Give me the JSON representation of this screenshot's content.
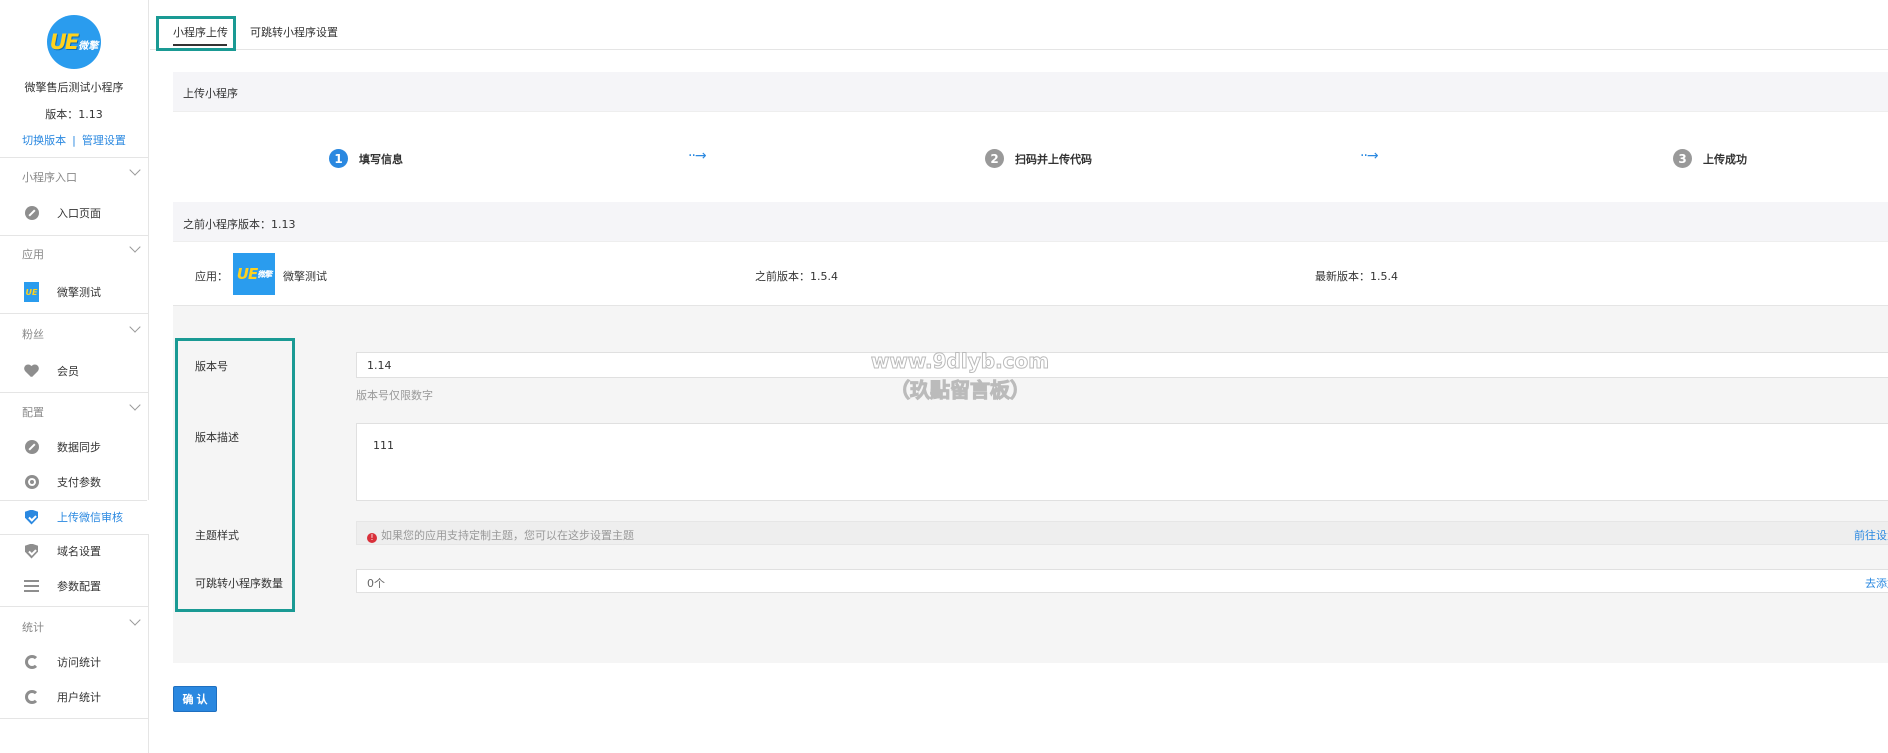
{
  "sidebar": {
    "app_name": "微擎售后测试小程序",
    "version": "版本：1.13",
    "links": {
      "switch_version": "切换版本",
      "separator": "|",
      "manage_settings": "管理设置"
    },
    "groups": [
      {
        "title": "小程序入口",
        "items": [
          {
            "label": "入口页面",
            "icon": "link-icon"
          }
        ]
      },
      {
        "title": "应用",
        "items": [
          {
            "label": "微擎测试",
            "icon": "app-logo-icon"
          }
        ]
      },
      {
        "title": "粉丝",
        "items": [
          {
            "label": "会员",
            "icon": "heart-icon"
          }
        ]
      },
      {
        "title": "配置",
        "items": [
          {
            "label": "数据同步",
            "icon": "link-icon"
          },
          {
            "label": "支付参数",
            "icon": "gear-icon"
          },
          {
            "label": "上传微信审核",
            "icon": "shield-icon",
            "active": true
          },
          {
            "label": "域名设置",
            "icon": "shield-icon"
          },
          {
            "label": "参数配置",
            "icon": "list-icon"
          }
        ]
      },
      {
        "title": "统计",
        "items": [
          {
            "label": "访问统计",
            "icon": "pie-icon"
          },
          {
            "label": "用户统计",
            "icon": "pie-icon"
          }
        ]
      }
    ]
  },
  "tabs": [
    {
      "label": "小程序上传",
      "active": true
    },
    {
      "label": "可跳转小程序设置"
    }
  ],
  "upload": {
    "title": "上传小程序",
    "steps": [
      {
        "num": "1",
        "label": "填写信息",
        "active": true
      },
      {
        "num": "2",
        "label": "扫码并上传代码"
      },
      {
        "num": "3",
        "label": "上传成功"
      }
    ],
    "arrow": "··→"
  },
  "previous": {
    "title": "之前小程序版本：1.13",
    "app_label": "应用：",
    "app_name": "微擎测试",
    "prev_version": "之前版本：1.5.4",
    "latest_version": "最新版本：1.5.4"
  },
  "form": {
    "version_label": "版本号",
    "version_value": "1.14",
    "version_hint": "版本号仅限数字",
    "desc_label": "版本描述",
    "desc_value": "111",
    "theme_label": "主题样式",
    "theme_notice": "如果您的应用支持定制主题，您可以在这步设置主题",
    "theme_link": "前往设置",
    "jump_label": "可跳转小程序数量",
    "jump_value": "0个",
    "jump_link": "去添加"
  },
  "confirm_label": "确 认",
  "logo_text": "UE微擎",
  "watermark": {
    "line1": "www.9dlyb.com",
    "line2": "（玖點留言板）"
  },
  "colors": {
    "accent": "#2a88e0",
    "highlight_box": "#1a9a94",
    "logo_blue": "#2a9cee"
  }
}
